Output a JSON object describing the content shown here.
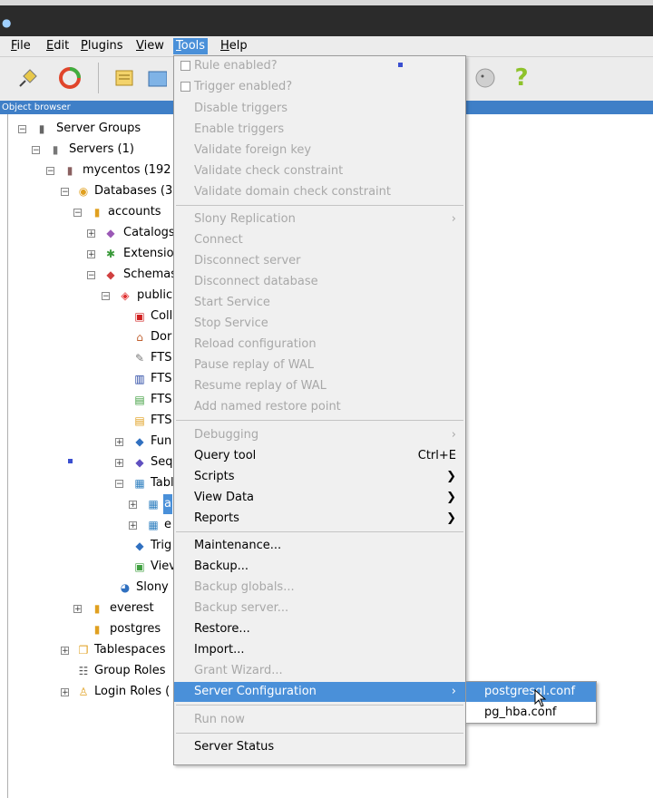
{
  "menubar": {
    "items": [
      {
        "pre": "",
        "u": "F",
        "post": "ile"
      },
      {
        "pre": "",
        "u": "E",
        "post": "dit"
      },
      {
        "pre": "",
        "u": "P",
        "post": "lugins"
      },
      {
        "pre": "",
        "u": "V",
        "post": "iew"
      },
      {
        "pre": "",
        "u": "T",
        "post": "ools"
      },
      {
        "pre": "",
        "u": "H",
        "post": "elp"
      }
    ]
  },
  "pane": {
    "title": "Object browser"
  },
  "tree": {
    "nodes": [
      "Server Groups",
      "Servers (1)",
      "mycentos (192",
      "Databases (3",
      "accounts",
      "Catalogs",
      "Extensio",
      "Schemas",
      "public",
      "Coll",
      "Dor",
      "FTS",
      "FTS",
      "FTS",
      "FTS",
      "Fun",
      "Seq",
      "Tabl",
      "a",
      "e",
      "Trig",
      "Viev",
      "Slony Re",
      "everest",
      "postgres",
      "Tablespaces",
      "Group Roles",
      "Login Roles ("
    ]
  },
  "menu": {
    "items": [
      {
        "label": "Rule enabled?",
        "type": "check",
        "disabled": true
      },
      {
        "label": "Trigger enabled?",
        "type": "check",
        "disabled": true
      },
      {
        "label": "Disable triggers",
        "disabled": true
      },
      {
        "label": "Enable triggers",
        "disabled": true
      },
      {
        "label": "Validate foreign key",
        "disabled": true
      },
      {
        "label": "Validate check constraint",
        "disabled": true
      },
      {
        "label": "Validate domain check constraint",
        "disabled": true
      },
      {
        "label": "Slony Replication",
        "disabled": true,
        "submenu": true
      },
      {
        "label": "Connect",
        "disabled": true,
        "u": "C"
      },
      {
        "label": "Disconnect server",
        "disabled": true
      },
      {
        "label": "Disconnect database",
        "disabled": true
      },
      {
        "label": "Start Service",
        "disabled": true
      },
      {
        "label": "Stop Service",
        "disabled": true
      },
      {
        "label": "Reload configuration",
        "disabled": true
      },
      {
        "label": "Pause replay of WAL",
        "disabled": true
      },
      {
        "label": "Resume replay of WAL",
        "disabled": true
      },
      {
        "label": "Add named restore point",
        "disabled": true
      },
      {
        "label": "Debugging",
        "disabled": true,
        "submenu": true
      },
      {
        "label": "Query tool",
        "shortcut": "Ctrl+E",
        "u": "Q"
      },
      {
        "label": "Scripts",
        "submenu": true
      },
      {
        "label": "View Data",
        "submenu": true
      },
      {
        "label": "Reports",
        "submenu": true,
        "u": "R"
      },
      {
        "label": "Maintenance...",
        "u": "M"
      },
      {
        "label": "Backup...",
        "u": "B"
      },
      {
        "label": "Backup globals...",
        "disabled": true
      },
      {
        "label": "Backup server...",
        "disabled": true
      },
      {
        "label": "Restore...",
        "u": "R"
      },
      {
        "label": "Import...",
        "u": "I"
      },
      {
        "label": "Grant Wizard...",
        "disabled": true
      },
      {
        "label": "Server Configuration",
        "submenu": true,
        "highlighted": true
      },
      {
        "label": "Run now",
        "disabled": true
      },
      {
        "label": "Server Status",
        "u": "S"
      }
    ]
  },
  "submenu": {
    "items": [
      {
        "label": "postgresql.conf",
        "highlighted": true
      },
      {
        "label": "pg_hba.conf"
      }
    ]
  },
  "colors": {
    "accent": "#4a90d9",
    "pane_header": "#3f7fc7",
    "titlebar": "#2b2b2b"
  }
}
